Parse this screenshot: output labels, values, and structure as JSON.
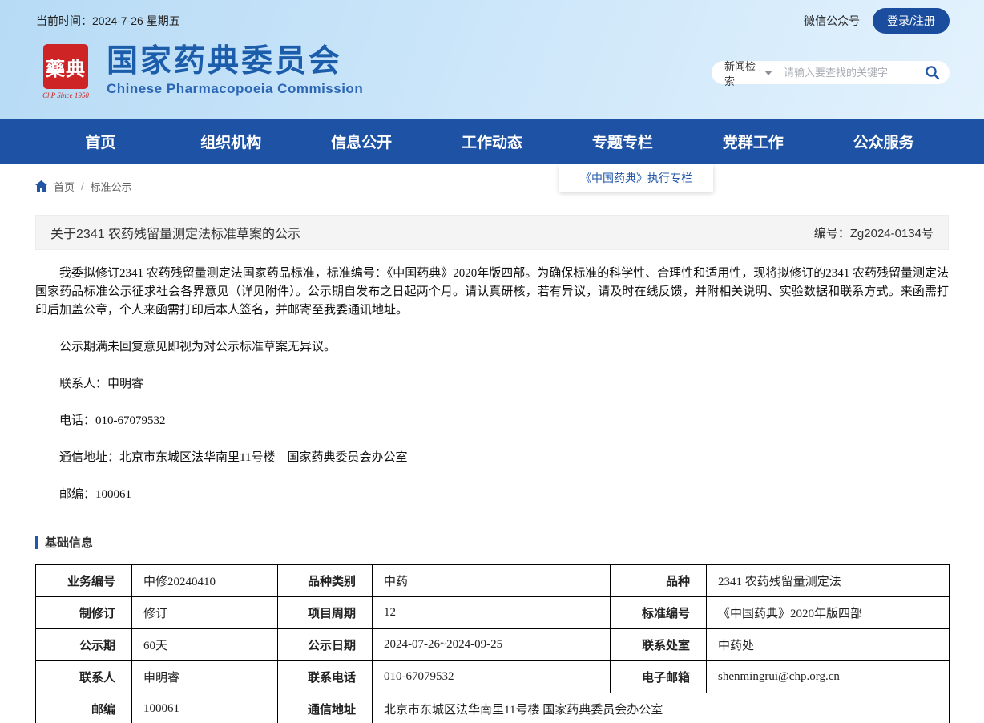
{
  "top_bar": {
    "current_time": "当前时间：2024-7-26 星期五",
    "wechat_label": "微信公众号",
    "login_label": "登录/注册"
  },
  "header": {
    "logo_seal_text": "藥典",
    "logo_caption": "ChP Since 1950",
    "site_name": "国家药典委员会",
    "site_name_en": "Chinese Pharmacopoeia Commission",
    "search": {
      "category": "新闻检索",
      "placeholder": "请输入要查找的关键字"
    }
  },
  "nav": {
    "items": [
      "首页",
      "组织机构",
      "信息公开",
      "工作动态",
      "专题专栏",
      "党群工作",
      "公众服务"
    ],
    "dropdown_item": "《中国药典》执行专栏"
  },
  "breadcrumb": {
    "home": "首页",
    "separator": "/",
    "current": "标准公示"
  },
  "notice": {
    "title": "关于2341 农药残留量测定法标准草案的公示",
    "doc_number": "编号：Zg2024-0134号",
    "paragraphs": [
      "我委拟修订2341 农药残留量测定法国家药品标准，标准编号：《中国药典》2020年版四部。为确保标准的科学性、合理性和适用性，现将拟修订的2341 农药残留量测定法国家药品标准公示征求社会各界意见（详见附件）。公示期自发布之日起两个月。请认真研核，若有异议，请及时在线反馈，并附相关说明、实验数据和联系方式。来函需打印后加盖公章，个人来函需打印后本人签名，并邮寄至我委通讯地址。",
      "公示期满未回复意见即视为对公示标准草案无异议。",
      "联系人：申明睿",
      "电话：010-67079532",
      "通信地址：北京市东城区法华南里11号楼　国家药典委员会办公室",
      "邮编：100061"
    ]
  },
  "basic_info": {
    "section_title": "基础信息",
    "rows": [
      {
        "cells": [
          {
            "label": "业务编号",
            "value": "中修20240410"
          },
          {
            "label": "品种类别",
            "value": "中药"
          },
          {
            "label": "品种",
            "value": "2341 农药残留量测定法"
          }
        ]
      },
      {
        "cells": [
          {
            "label": "制修订",
            "value": "修订"
          },
          {
            "label": "项目周期",
            "value": "12"
          },
          {
            "label": "标准编号",
            "value": "《中国药典》2020年版四部"
          }
        ]
      },
      {
        "cells": [
          {
            "label": "公示期",
            "value": "60天"
          },
          {
            "label": "公示日期",
            "value": "2024-07-26~2024-09-25"
          },
          {
            "label": "联系处室",
            "value": "中药处"
          }
        ]
      },
      {
        "cells": [
          {
            "label": "联系人",
            "value": "申明睿"
          },
          {
            "label": "联系电话",
            "value": "010-67079532"
          },
          {
            "label": "电子邮箱",
            "value": "shenmingrui@chp.org.cn"
          }
        ]
      },
      {
        "cells": [
          {
            "label": "邮编",
            "value": "100061"
          },
          {
            "label": "通信地址",
            "value": "北京市东城区法华南里11号楼 国家药典委员会办公室"
          }
        ]
      }
    ]
  },
  "colors": {
    "nav_blue": "#1d52a4",
    "brand_blue": "#1b5cab",
    "accent_blue": "#2257a8",
    "logo_red": "#cf2426",
    "login_button_blue": "#1a4d9e"
  }
}
